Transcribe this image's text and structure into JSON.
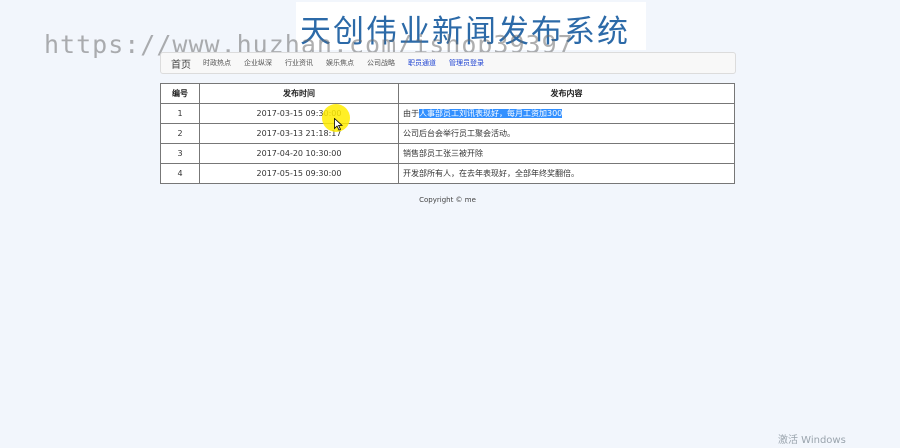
{
  "header": {
    "title": "天创伟业新闻发布系统",
    "watermark": "https://www.huzhan.com/ishop39397"
  },
  "nav": {
    "home": "首页",
    "items": [
      {
        "label": "时政热点"
      },
      {
        "label": "企业纵深"
      },
      {
        "label": "行业资讯"
      },
      {
        "label": "娱乐焦点"
      },
      {
        "label": "公司战略"
      },
      {
        "label": "职员通道"
      },
      {
        "label": "管理员登录"
      }
    ]
  },
  "table": {
    "headers": [
      "编号",
      "发布时间",
      "发布内容"
    ],
    "rows": [
      {
        "id": "1",
        "time": "2017-03-15 09:30:00",
        "content_prefix": "由于",
        "content_highlight": "人事部员工刘讯表现好，每月工资加300"
      },
      {
        "id": "2",
        "time": "2017-03-13 21:18:17",
        "content": "公司后台会举行员工聚会活动。"
      },
      {
        "id": "3",
        "time": "2017-04-20 10:30:00",
        "content": "销售部员工张三被开除"
      },
      {
        "id": "4",
        "time": "2017-05-15 09:30:00",
        "content": "开发部所有人，在去年表现好，全部年终奖翻倍。"
      }
    ]
  },
  "footer": {
    "copyright": "Copyright © me"
  },
  "os": {
    "activate": "激活 Windows"
  },
  "colors": {
    "title": "#2c6aa8",
    "selection": "#3390ff",
    "admin_link": "#1a3fd1",
    "cursor_highlight": "#ffec00"
  }
}
